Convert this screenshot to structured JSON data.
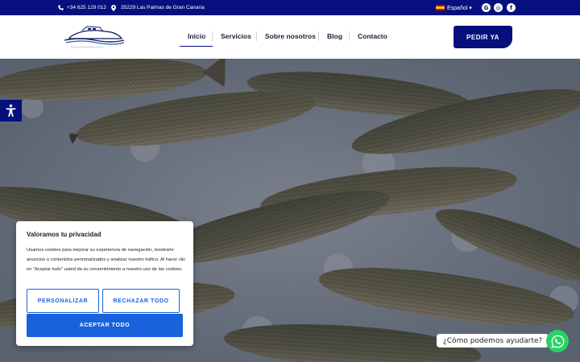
{
  "topbar": {
    "phone": "+34 625 129 012",
    "address": "35229 Las Palmas de Gran Canaria",
    "language": "Español ▾",
    "social": [
      {
        "icon": "google-icon",
        "glyph": "G"
      },
      {
        "icon": "instagram-icon",
        "glyph": "◎"
      },
      {
        "icon": "facebook-icon",
        "glyph": "f"
      }
    ],
    "bg_color": "#05107c"
  },
  "nav": {
    "items": [
      "Inicio",
      "Servicios",
      "Sobre nosotros",
      "Blog",
      "Contacto"
    ],
    "active": "Inicio",
    "cta": "PEDIR YA"
  },
  "cookie": {
    "title": "Valoramos tu privacidad",
    "text": "Usamos cookies para mejorar su experiencia de navegación, mostrarle anuncios o contenidos personalizados y analizar nuestro tráfico. Al hacer clic en \"Aceptar todo\" usted da su consentimiento a nuestro uso de las cookies.",
    "customize": "PERSONALIZAR",
    "reject": "RECHAZAR TODO",
    "accept": "ACEPTAR TODO",
    "accent_color": "#1863dc"
  },
  "whatsapp": {
    "label": "¿Cómo podemos ayudarte?",
    "color": "#25d366"
  }
}
